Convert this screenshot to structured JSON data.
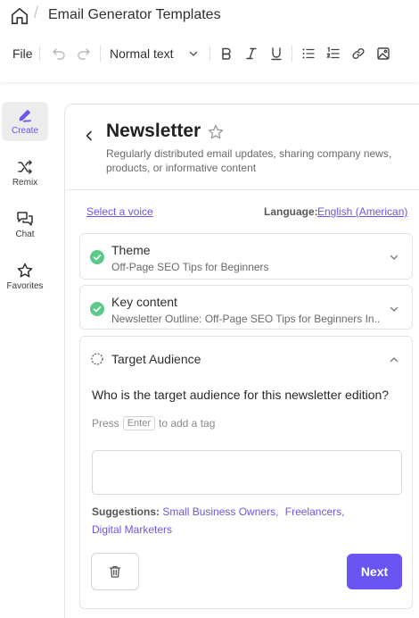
{
  "header": {
    "doc_title": "Email Generator Templates",
    "breadcrumb_separator": "/"
  },
  "toolbar": {
    "file_label": "File",
    "text_style": "Normal text",
    "icons": [
      "undo-icon",
      "redo-icon",
      "chevron-down-icon",
      "bold-icon",
      "italic-icon",
      "underline-icon",
      "bullet-list-icon",
      "numbered-list-icon",
      "link-icon",
      "image-icon"
    ]
  },
  "sidebar": {
    "items": [
      {
        "label": "Create",
        "icon": "create-pen-icon",
        "active": true
      },
      {
        "label": "Remix",
        "icon": "shuffle-icon",
        "active": false
      },
      {
        "label": "Chat",
        "icon": "chat-bubbles-icon",
        "active": false
      },
      {
        "label": "Favorites",
        "icon": "star-icon",
        "active": false
      }
    ]
  },
  "template": {
    "title": "Newsletter",
    "description": "Regularly distributed email updates, sharing company news, products, or informative content",
    "select_voice": "Select a voice",
    "language_label": "Language:",
    "language_value": "English (American)"
  },
  "steps": [
    {
      "title": "Theme",
      "value": "Off-Page SEO Tips for Beginners",
      "status": "complete"
    },
    {
      "title": "Key content",
      "value": "Newsletter Outline: Off-Page SEO Tips for Beginners In...",
      "status": "complete"
    }
  ],
  "target_audience": {
    "title": "Target Audience",
    "question": "Who is the target audience for this newsletter edition?",
    "hint_press": "Press",
    "hint_key": "Enter",
    "hint_rest": "to add a tag",
    "input_value": "",
    "suggestions_label": "Suggestions:",
    "suggestions": [
      "Small Business Owners,",
      "Freelancers,",
      "Digital Marketers"
    ],
    "next_label": "Next"
  },
  "colors": {
    "accent": "#6b55f2",
    "link": "#6a56e6",
    "success": "#5cc98a"
  }
}
